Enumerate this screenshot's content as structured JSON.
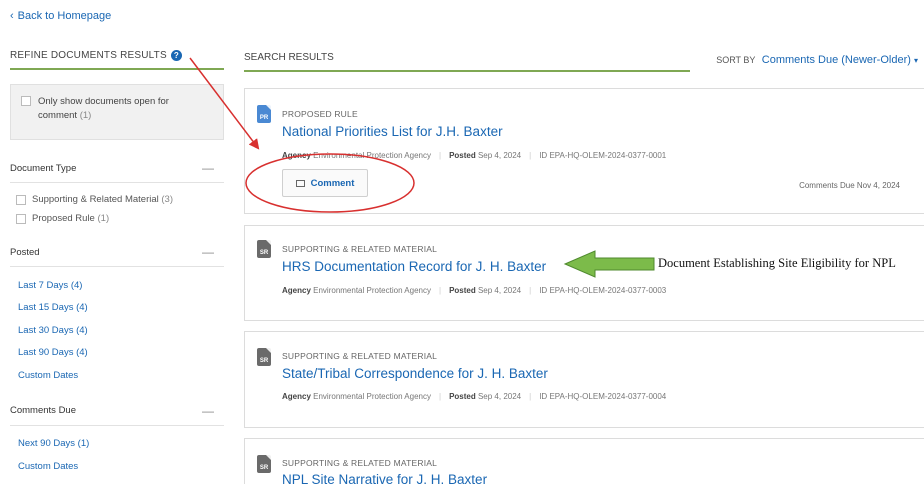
{
  "back_link": {
    "label": "Back to Homepage"
  },
  "sidebar": {
    "header": "REFINE DOCUMENTS RESULTS",
    "open_only": {
      "label": "Only show documents open for comment",
      "count": "(1)"
    },
    "document_type": {
      "title": "Document Type",
      "items": [
        {
          "label": "Supporting & Related Material",
          "count": "(3)"
        },
        {
          "label": "Proposed Rule",
          "count": "(1)"
        }
      ]
    },
    "posted": {
      "title": "Posted",
      "items": [
        {
          "label": "Last 7 Days",
          "count": "(4)"
        },
        {
          "label": "Last 15 Days",
          "count": "(4)"
        },
        {
          "label": "Last 30 Days",
          "count": "(4)"
        },
        {
          "label": "Last 90 Days",
          "count": "(4)"
        },
        {
          "label": "Custom Dates",
          "count": ""
        }
      ]
    },
    "comments_due": {
      "title": "Comments Due",
      "items": [
        {
          "label": "Next 90 Days",
          "count": "(1)"
        },
        {
          "label": "Custom Dates",
          "count": ""
        }
      ]
    },
    "collapse_symbol": "—"
  },
  "results": {
    "header": "SEARCH RESULTS",
    "sort_label": "SORT BY",
    "sort_value": "Comments Due (Newer-Older)",
    "sort_caret": "▾",
    "meta_labels": {
      "agency": "Agency",
      "posted": "Posted",
      "id": "ID"
    },
    "cards": [
      {
        "icon_text": "PR",
        "kind": "PROPOSED RULE",
        "title": "National Priorities List for J.H. Baxter",
        "agency": "Environmental Protection Agency",
        "posted": "Sep 4, 2024",
        "id": "EPA-HQ-OLEM-2024-0377-0001",
        "comment_button": "Comment",
        "comments_due": "Comments Due Nov 4, 2024"
      },
      {
        "icon_text": "SR",
        "kind": "SUPPORTING & RELATED MATERIAL",
        "title": "HRS Documentation Record for J. H. Baxter",
        "agency": "Environmental Protection Agency",
        "posted": "Sep 4, 2024",
        "id": "EPA-HQ-OLEM-2024-0377-0003"
      },
      {
        "icon_text": "SR",
        "kind": "SUPPORTING & RELATED MATERIAL",
        "title": "State/Tribal Correspondence for J. H. Baxter",
        "agency": "Environmental Protection Agency",
        "posted": "Sep 4, 2024",
        "id": "EPA-HQ-OLEM-2024-0377-0004"
      },
      {
        "icon_text": "SR",
        "kind": "SUPPORTING & RELATED MATERIAL",
        "title": "NPL Site Narrative for J. H. Baxter"
      }
    ]
  },
  "annotations": {
    "npl_label": "Document Establishing Site Eligibility for NPL",
    "arrow_red": "#d8302f",
    "arrow_green": "#7cbb4a",
    "ellipse_color": "#d8302f"
  }
}
